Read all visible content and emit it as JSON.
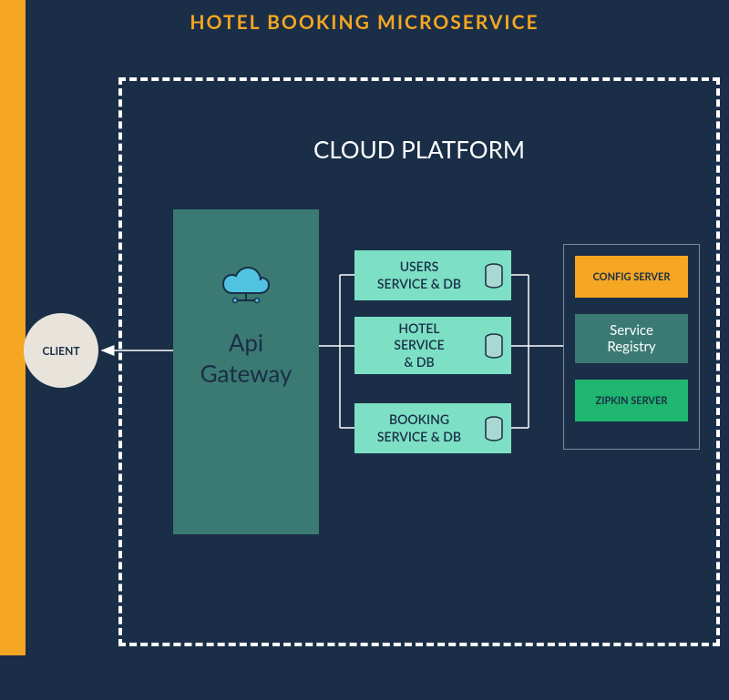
{
  "title": "HOTEL BOOKING MICROSERVICE",
  "cloud_platform_title": "CLOUD PLATFORM",
  "client_label": "CLIENT",
  "api_gateway": {
    "line1": "Api",
    "line2": "Gateway"
  },
  "services": {
    "users": "USERS SERVICE & DB",
    "hotel": "HOTEL SERVICE & DB",
    "booking": "BOOKING SERVICE & DB"
  },
  "servers": {
    "config": "CONFIG SERVER",
    "registry": "Service Registry",
    "zipkin": "ZIPKIN SERVER"
  }
}
